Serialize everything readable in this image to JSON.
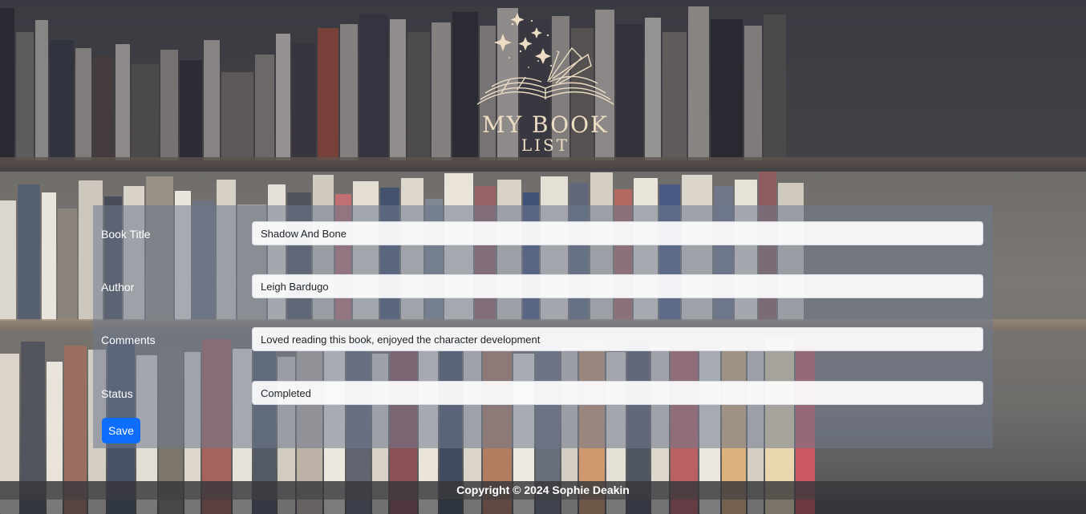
{
  "header": {
    "logo_title": "MY BOOK",
    "logo_subtitle": "LIST",
    "logo_icon": "open-book-stars-icon"
  },
  "form": {
    "fields": [
      {
        "label": "Book Title",
        "value": "Shadow And Bone"
      },
      {
        "label": "Author",
        "value": "Leigh Bardugo"
      },
      {
        "label": "Comments",
        "value": "Loved reading this book, enjoyed the character development"
      },
      {
        "label": "Status",
        "value": "Completed"
      }
    ],
    "save_label": "Save"
  },
  "footer": {
    "copyright": "Copyright © 2024 Sophie Deakin"
  },
  "colors": {
    "accent": "#0d6efd",
    "logo": "#ecdcc4",
    "panel": "#6e788c"
  }
}
